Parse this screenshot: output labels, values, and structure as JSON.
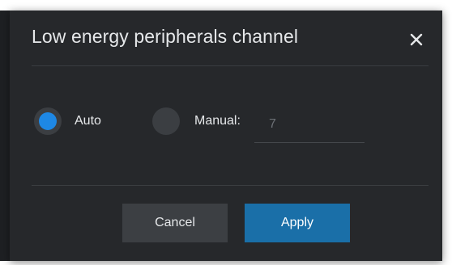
{
  "dialog": {
    "title": "Low energy peripherals channel",
    "close_icon": "close-icon"
  },
  "channel_mode": {
    "selected": "auto",
    "auto_label": "Auto",
    "manual_label": "Manual:",
    "manual_value_placeholder": "7"
  },
  "actions": {
    "cancel_label": "Cancel",
    "apply_label": "Apply"
  },
  "colors": {
    "dialog_bg": "#26282b",
    "accent": "#1e88e5",
    "apply_bg": "#1a6fa8",
    "cancel_bg": "#3c3f43"
  }
}
